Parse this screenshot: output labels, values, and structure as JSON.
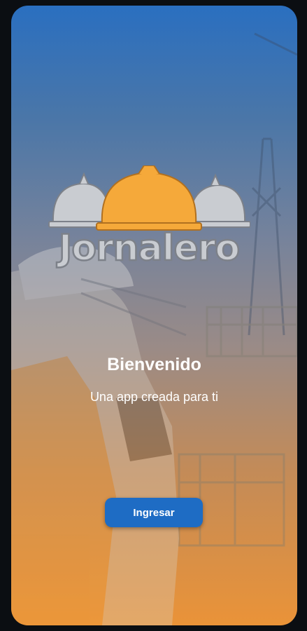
{
  "colors": {
    "gradient_top": "#2a6fc0",
    "gradient_bottom": "#ea9338",
    "button_bg": "#1e6cc4",
    "helmet_center": "#f5a93a",
    "helmet_sides": "#c9ccd1"
  },
  "logo": {
    "text": "Jornalero",
    "icon": "hard-hats-icon"
  },
  "welcome": {
    "title": "Bienvenido",
    "subtitle": "Una app creada para ti"
  },
  "actions": {
    "enter_label": "Ingresar"
  }
}
